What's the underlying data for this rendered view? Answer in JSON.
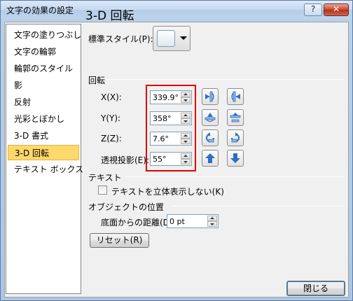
{
  "window": {
    "title": "文字の効果の設定",
    "help_label": "?",
    "close_label": "✕"
  },
  "sidebar": {
    "items": [
      {
        "label": "文字の塗りつぶし",
        "selected": false
      },
      {
        "label": "文字の輪郭",
        "selected": false
      },
      {
        "label": "輪郭のスタイル",
        "selected": false
      },
      {
        "label": "影",
        "selected": false
      },
      {
        "label": "反射",
        "selected": false
      },
      {
        "label": "光彩とぼかし",
        "selected": false
      },
      {
        "label": "3-D 書式",
        "selected": false
      },
      {
        "label": "3-D 回転",
        "selected": true
      },
      {
        "label": "テキスト ボックス",
        "selected": false
      }
    ]
  },
  "panel": {
    "heading": "3-D 回転",
    "preset_label": "標準スタイル(P):",
    "rotation": {
      "title": "回転",
      "x": {
        "label": "X(X):",
        "value": "339.9°"
      },
      "y": {
        "label": "Y(Y):",
        "value": "358°"
      },
      "z": {
        "label": "Z(Z):",
        "value": "7.6°"
      },
      "perspective": {
        "label": "透視投影(E):",
        "value": "55°"
      }
    },
    "text": {
      "title": "テキスト",
      "keep_flat_label": "テキストを立体表示しない(K)",
      "keep_flat_checked": false
    },
    "object_position": {
      "title": "オブジェクトの位置",
      "distance_label": "底面からの距離(D):",
      "distance_value": "0 pt"
    },
    "reset_label": "リセット(R)"
  },
  "footer": {
    "close_label": "閉じる"
  },
  "colors": {
    "selection_fill": "#ffd86b",
    "highlight_border": "#e00000",
    "icon_blue": "#2f6fc1"
  },
  "icons": {
    "x_left": "rotate-left-icon",
    "x_right": "rotate-right-icon",
    "y_up": "rotate-up-icon",
    "y_down": "rotate-down-icon",
    "z_ccw": "rotate-counterclockwise-icon",
    "z_cw": "rotate-clockwise-icon",
    "persp_narrow": "perspective-narrow-icon",
    "persp_widen": "perspective-widen-icon"
  }
}
